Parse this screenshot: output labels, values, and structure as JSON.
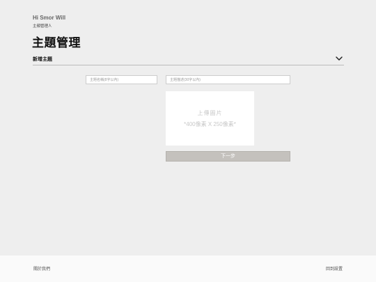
{
  "header": {
    "greeting": "Hi Smor Will",
    "role": "主頻管理人",
    "page_title": "主題管理"
  },
  "section": {
    "label": "新增主題",
    "toggle_icon": "chevron-down-icon"
  },
  "form": {
    "name_placeholder": "主題名稱(8字以內)",
    "name_value": "",
    "desc_placeholder": "主題描述(30字以內)",
    "desc_value": "",
    "upload_line1": "上傳圖片",
    "upload_line2": "*400像素 X 250像素*",
    "next_label": "下一步"
  },
  "footer": {
    "about": "關於我們",
    "back": "回到設置"
  },
  "colors": {
    "background": "#eeeeee",
    "button": "#c4c1bd",
    "footer": "#fafafa"
  }
}
